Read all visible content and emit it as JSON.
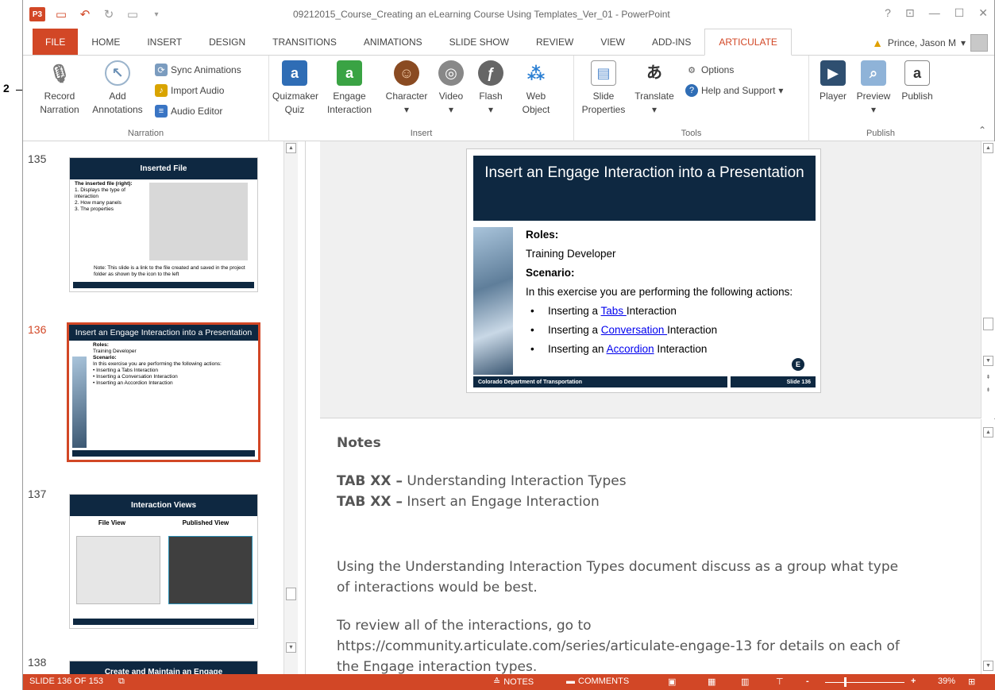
{
  "callout": {
    "number": "2"
  },
  "titlebar": {
    "title": "09212015_Course_Creating an eLearning Course Using Templates_Ver_01 - PowerPoint",
    "app_icon": "P3",
    "help": "?",
    "ribbon_display": "⊡",
    "minimize": "—",
    "maximize": "☐",
    "close": "✕"
  },
  "tabs": [
    "FILE",
    "HOME",
    "INSERT",
    "DESIGN",
    "TRANSITIONS",
    "ANIMATIONS",
    "SLIDE SHOW",
    "REVIEW",
    "VIEW",
    "ADD-INS",
    "ARTICULATE"
  ],
  "user": {
    "name": "Prince, Jason M",
    "dropdown": "▾"
  },
  "ribbon": {
    "narration": {
      "label": "Narration",
      "record": "Record Narration",
      "add_annotations": "Add Annotations",
      "sync_animations": "Sync Animations",
      "import_audio": "Import Audio",
      "audio_editor": "Audio Editor"
    },
    "insert": {
      "label": "Insert",
      "quizmaker": "Quizmaker Quiz",
      "engage": "Engage Interaction",
      "character": "Character",
      "video": "Video",
      "flash": "Flash",
      "web_object": "Web Object",
      "dropdown": "▾"
    },
    "tools": {
      "label": "Tools",
      "slide_properties": "Slide Properties",
      "translate": "Translate",
      "options": "Options",
      "help_support": "Help and Support"
    },
    "publish": {
      "label": "Publish",
      "player": "Player",
      "preview": "Preview",
      "publish": "Publish"
    }
  },
  "thumbnails": [
    {
      "num": "135",
      "title": "Inserted File",
      "lines": [
        "The inserted file (right):",
        "1. Displays the type of interaction",
        "2. How many panels",
        "3. The properties"
      ],
      "note": "Note: This slide is a link to the file created and saved in the project folder as shown by the icon to the left"
    },
    {
      "num": "136",
      "title": "Insert an Engage Interaction into a Presentation",
      "lines": [
        "Roles:",
        "Training Developer",
        "Scenario:",
        "In this exercise you are performing the following actions:",
        "• Inserting a Tabs Interaction",
        "• Inserting a Conversation Interaction",
        "• Inserting an Accordion Interaction"
      ]
    },
    {
      "num": "137",
      "title": "Interaction Views",
      "col1": "File View",
      "col2": "Published View"
    },
    {
      "num": "138",
      "title": "Create and Maintain an Engage"
    }
  ],
  "thumb_footer": "Colorado Department of Transportation",
  "main_slide": {
    "title": "Insert an Engage Interaction into a Presentation",
    "roles_label": "Roles:",
    "roles": "Training Developer",
    "scenario_label": "Scenario:",
    "scenario": "In this exercise you are performing the following actions:",
    "bullets": [
      {
        "pre": "Inserting a ",
        "link": "Tabs ",
        "post": "Interaction"
      },
      {
        "pre": "Inserting a ",
        "link": "Conversation ",
        "post": "Interaction"
      },
      {
        "pre": "Inserting an ",
        "link": "Accordion",
        "post": " Interaction"
      }
    ],
    "footer_left": "Colorado Department of Transportation",
    "footer_right": "Slide 136",
    "badge": "E"
  },
  "notes": {
    "heading": "Notes",
    "line1_bold": "TAB XX –",
    "line1": " Understanding Interaction Types",
    "line2_bold": "TAB XX –",
    "line2": " Insert an Engage Interaction",
    "para1a": "Using the Understanding Interaction Types document discuss as a group what type",
    "para1b": "of interactions would be best.",
    "para2a": "To review all of the interactions, go to",
    "para2b": "https://community.articulate.com/series/articulate-engage-13 for details on each of",
    "para2c": "the Engage interaction types."
  },
  "statusbar": {
    "slide": "SLIDE 136 OF 153",
    "notes": "NOTES",
    "comments": "COMMENTS",
    "zoom": "39%",
    "zoom_minus": "-",
    "zoom_plus": "+"
  },
  "colors": {
    "accent": "#d24726",
    "navy": "#0e2841"
  }
}
